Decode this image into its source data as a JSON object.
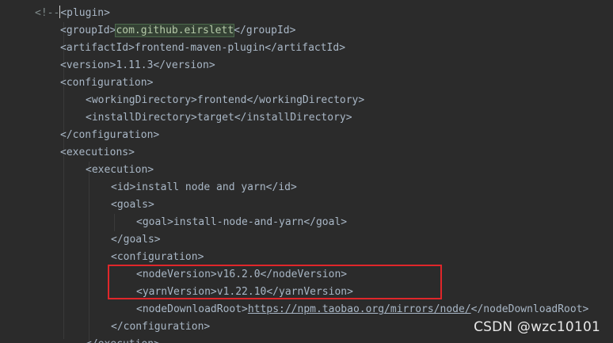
{
  "lines": [
    {
      "indent": 44,
      "prefix": "<!--",
      "text": "<plugin>"
    },
    {
      "indent": 76,
      "text": "<groupId>",
      "highlight": "com.github.eirslett",
      "suffix": "</groupId>"
    },
    {
      "indent": 76,
      "text": "<artifactId>frontend-maven-plugin</artifactId>"
    },
    {
      "indent": 76,
      "text": "<version>1.11.3</version>"
    },
    {
      "indent": 76,
      "text": "<configuration>"
    },
    {
      "indent": 108,
      "text": "<workingDirectory>frontend</workingDirectory>"
    },
    {
      "indent": 108,
      "text": "<installDirectory>target</installDirectory>"
    },
    {
      "indent": 76,
      "text": "</configuration>"
    },
    {
      "indent": 76,
      "text": "<executions>"
    },
    {
      "indent": 108,
      "text": "<execution>"
    },
    {
      "indent": 140,
      "text": "<id>install node and yarn</id>"
    },
    {
      "indent": 140,
      "text": "<goals>"
    },
    {
      "indent": 172,
      "text": "<goal>install-node-and-yarn</goal>"
    },
    {
      "indent": 140,
      "text": "</goals>"
    },
    {
      "indent": 140,
      "text": "<configuration>"
    },
    {
      "indent": 172,
      "text": "<nodeVersion>v16.2.0</nodeVersion>"
    },
    {
      "indent": 172,
      "text": "<yarnVersion>v1.22.10</yarnVersion>"
    },
    {
      "indent": 172,
      "text": "<nodeDownloadRoot>",
      "link": "https://npm.taobao.org/mirrors/node/",
      "suffix": "</nodeDownloadRoot>"
    },
    {
      "indent": 140,
      "text": "</configuration>"
    },
    {
      "indent": 108,
      "text": "</execution>"
    }
  ],
  "watermark": "CSDN @wzc10101",
  "colors": {
    "background": "#2b2b2b",
    "text": "#a9b7c6",
    "highlight_bg": "#344134",
    "annotation_box": "#e0262a"
  }
}
